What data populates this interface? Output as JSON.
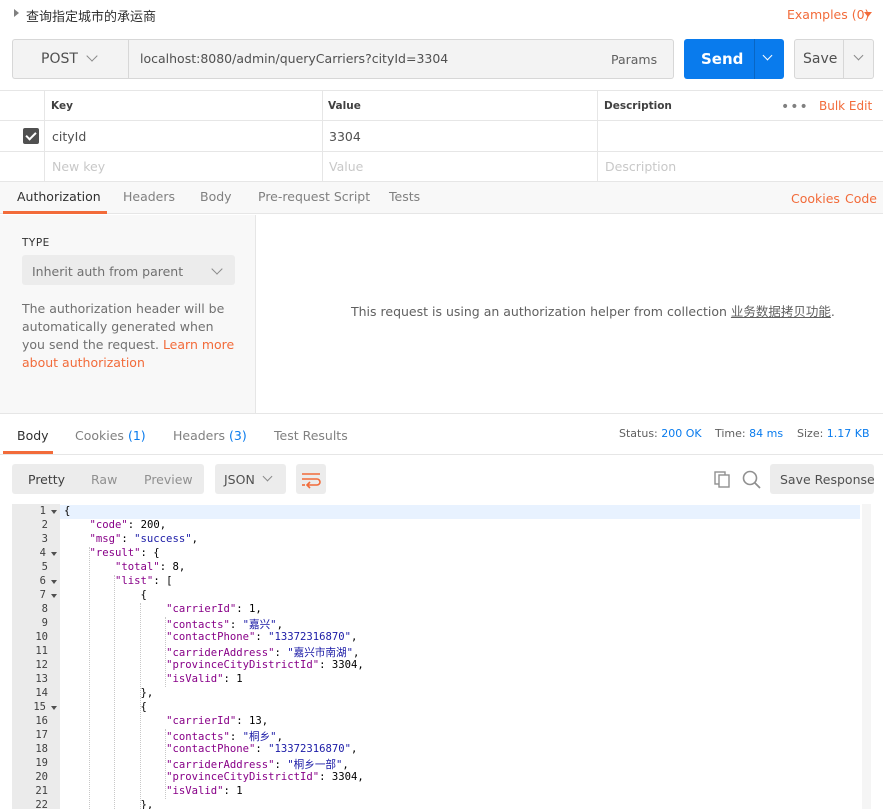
{
  "top": {
    "title": "查询指定城市的承运商",
    "examples": "Examples (0)"
  },
  "request": {
    "method": "POST",
    "url": "localhost:8080/admin/queryCarriers?cityId=3304",
    "params_label": "Params",
    "send_label": "Send",
    "save_label": "Save"
  },
  "params_table": {
    "headers": {
      "key": "Key",
      "value": "Value",
      "description": "Description"
    },
    "more": "•••",
    "bulk_edit": "Bulk Edit",
    "rows": [
      {
        "checked": true,
        "key": "cityId",
        "value": "3304",
        "description": ""
      }
    ],
    "placeholders": {
      "key": "New key",
      "value": "Value",
      "description": "Description"
    }
  },
  "req_tabs": {
    "items": [
      "Authorization",
      "Headers",
      "Body",
      "Pre-request Script",
      "Tests"
    ],
    "active": "Authorization",
    "cookies": "Cookies",
    "code": "Code"
  },
  "auth": {
    "type_label": "TYPE",
    "type_value": "Inherit auth from parent",
    "desc_1": "The authorization header will be automatically generated when you send the request. ",
    "learn_more": "Learn more about authorization",
    "helper_prefix": "This request is using an authorization helper from collection ",
    "collection_name": "业务数据拷贝功能",
    "helper_suffix": "."
  },
  "resp_tabs": {
    "body": "Body",
    "cookies": "Cookies",
    "cookies_count": "(1)",
    "headers": "Headers",
    "headers_count": "(3)",
    "tests": "Test Results"
  },
  "status": {
    "status_label": "Status:",
    "status_value": "200 OK",
    "time_label": "Time:",
    "time_value": "84 ms",
    "size_label": "Size:",
    "size_value": "1.17 KB"
  },
  "toolbar": {
    "pretty": "Pretty",
    "raw": "Raw",
    "preview": "Preview",
    "format": "JSON",
    "save_response": "Save Response"
  },
  "colors": {
    "accent": "#f26b3a",
    "send": "#097bed",
    "link": "#097bed"
  },
  "icons": [
    "caret-right-icon",
    "chevron-down-icon",
    "checkbox-checked-icon",
    "wrap-lines-icon",
    "copy-icon",
    "search-icon"
  ],
  "code": {
    "line_numbers": [
      "1",
      "2",
      "3",
      "4",
      "5",
      "6",
      "7",
      "8",
      "9",
      "10",
      "11",
      "12",
      "13",
      "14",
      "15",
      "16",
      "17",
      "18",
      "19",
      "20",
      "21",
      "22"
    ],
    "folds": [
      "1",
      "4",
      "6",
      "7",
      "15"
    ],
    "lines": [
      "{",
      "    \"code\": 200,",
      "    \"msg\": \"success\",",
      "    \"result\": {",
      "        \"total\": 8,",
      "        \"list\": [",
      "            {",
      "                \"carrierId\": 1,",
      "                \"contacts\": \"嘉兴\",",
      "                \"contactPhone\": \"13372316870\",",
      "                \"carriderAddress\": \"嘉兴市南湖\",",
      "                \"provinceCityDistrictId\": 3304,",
      "                \"isValid\": 1",
      "            },",
      "            {",
      "                \"carrierId\": 13,",
      "                \"contacts\": \"桐乡\",",
      "                \"contactPhone\": \"13372316870\",",
      "                \"carriderAddress\": \"桐乡一部\",",
      "                \"provinceCityDistrictId\": 3304,",
      "                \"isValid\": 1",
      "            },"
    ]
  }
}
